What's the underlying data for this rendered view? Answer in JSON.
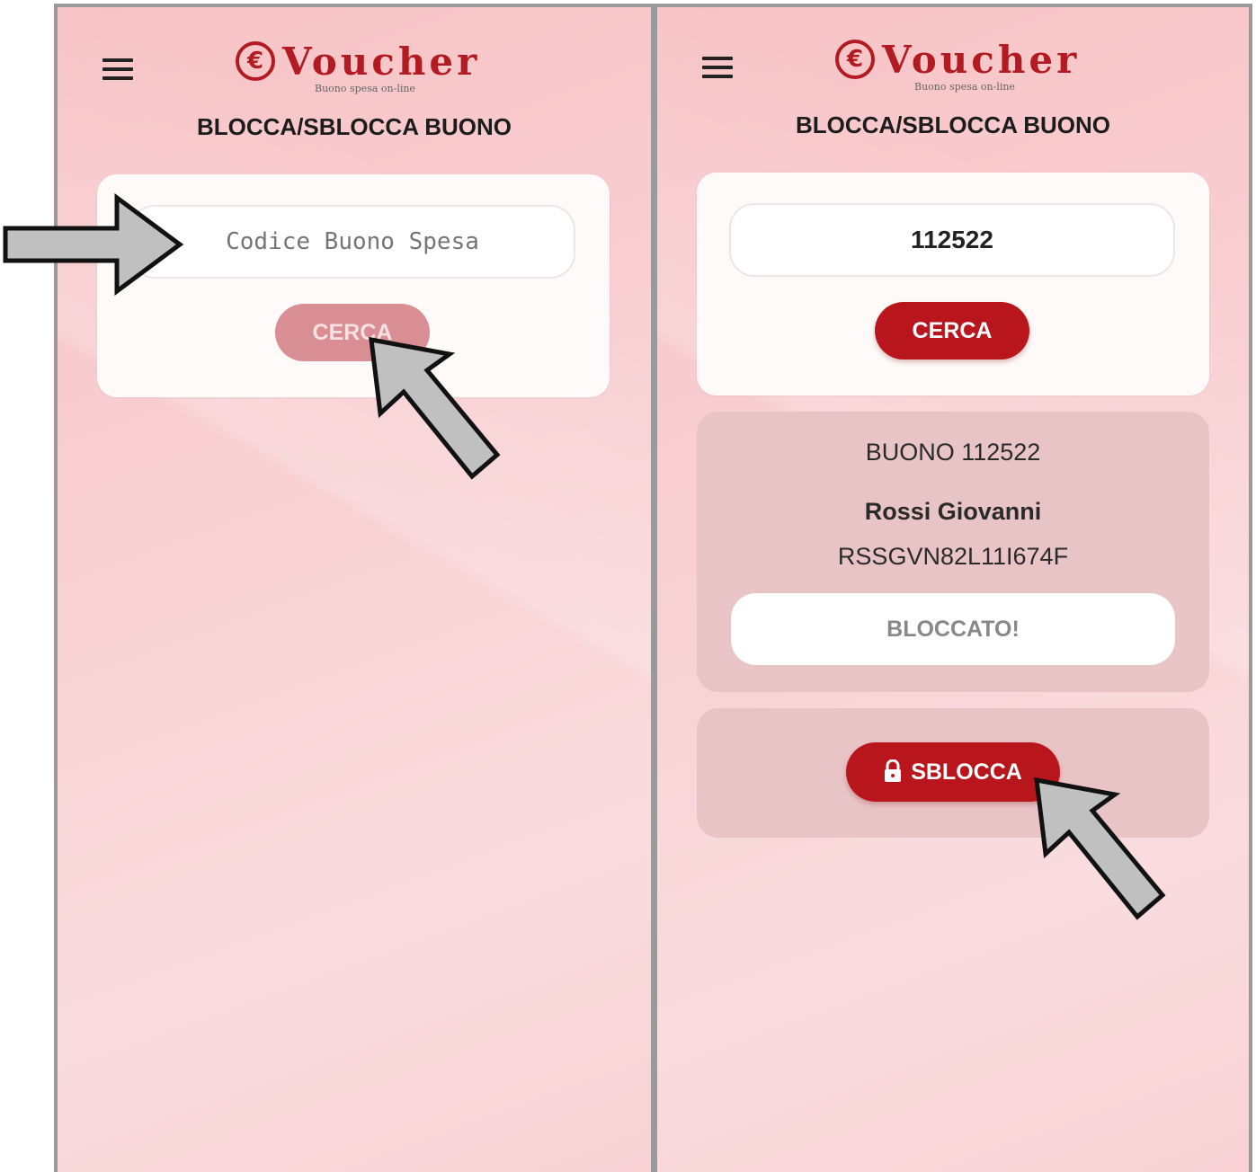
{
  "left_screen": {
    "brand": {
      "name": "Voucher",
      "symbol": "€",
      "tagline": "Buono spesa on-line"
    },
    "title": "BLOCCA/SBLOCCA BUONO",
    "search": {
      "placeholder": "Codice Buono Spesa",
      "value": "",
      "button_label": "CERCA"
    }
  },
  "right_screen": {
    "brand": {
      "name": "Voucher",
      "symbol": "€",
      "tagline": "Buono spesa on-line"
    },
    "title": "BLOCCA/SBLOCCA BUONO",
    "search": {
      "value": "112522",
      "button_label": "CERCA"
    },
    "result": {
      "voucher_label": "BUONO 112522",
      "holder_name": "Rossi Giovanni",
      "fiscal_code": "RSSGVN82L11I674F",
      "status": "BLOCCATO!"
    },
    "action": {
      "label": "SBLOCCA",
      "icon": "lock-icon"
    }
  },
  "colors": {
    "brand_red": "#b31b22",
    "button_red": "#b8151c",
    "button_disabled": "#d98e93",
    "background_pink": "#f8d0d3",
    "annotation_arrow": "#c0c0c0"
  }
}
